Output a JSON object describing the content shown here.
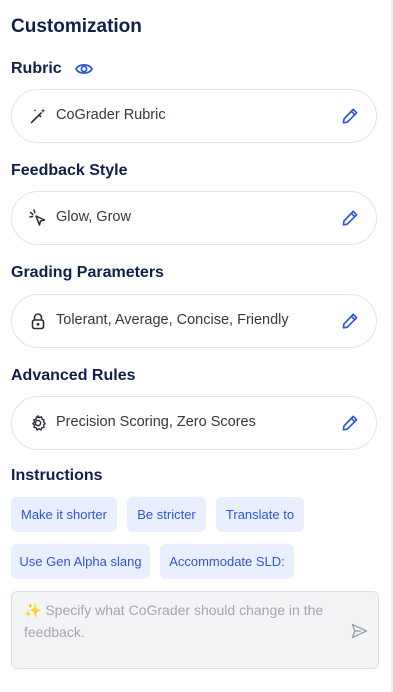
{
  "page": {
    "title": "Customization"
  },
  "rubric": {
    "heading": "Rubric",
    "value": "CoGrader Rubric"
  },
  "feedback_style": {
    "heading": "Feedback Style",
    "value": "Glow, Grow"
  },
  "grading_parameters": {
    "heading": "Grading Parameters",
    "value": "Tolerant, Average, Concise, Friendly"
  },
  "advanced_rules": {
    "heading": "Advanced Rules",
    "value": "Precision Scoring, Zero Scores"
  },
  "instructions": {
    "heading": "Instructions",
    "chips": [
      "Make it shorter",
      "Be stricter",
      "Translate to",
      "Use Gen Alpha slang",
      "Accommodate SLD:"
    ],
    "placeholder": "✨ Specify what CoGrader should change in the feedback."
  },
  "icons": {
    "eye": "eye-icon",
    "wand": "magic-wand-icon",
    "sparkle_cursor": "sparkle-pointer-icon",
    "lock": "lock-icon",
    "gear": "gear-icon",
    "edit": "pencil-icon",
    "send": "send-icon"
  },
  "colors": {
    "heading": "#10204a",
    "accent": "#2f57d6",
    "chip_bg": "#e9efff"
  }
}
